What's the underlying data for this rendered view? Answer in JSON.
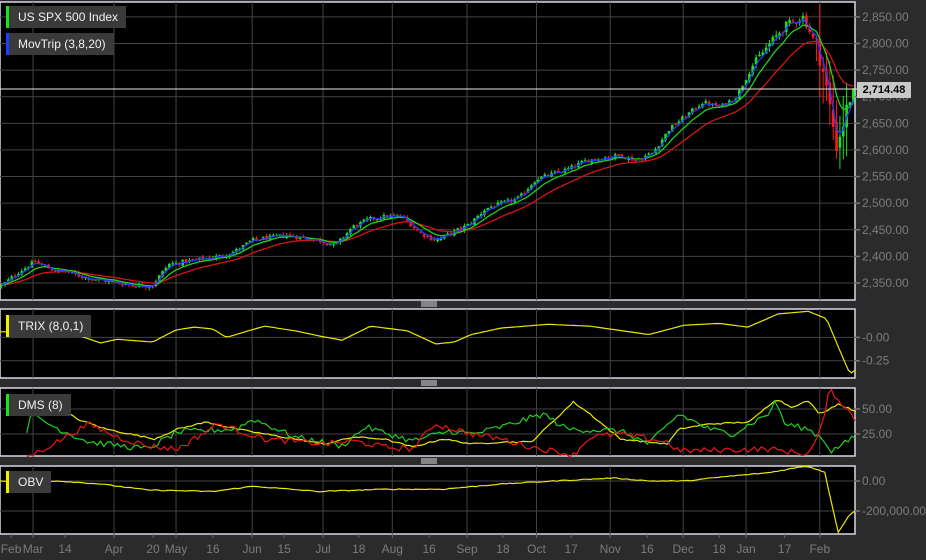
{
  "x_axis": {
    "ticks": [
      {
        "label": "Feb",
        "week": 0.66,
        "grid": false
      },
      {
        "label": "Mar",
        "week": 1.97,
        "grid": true
      },
      {
        "label": "14",
        "week": 3.88,
        "grid": false
      },
      {
        "label": "Apr",
        "week": 6.8,
        "grid": true
      },
      {
        "label": "20",
        "week": 9.13,
        "grid": false
      },
      {
        "label": "May",
        "week": 10.5,
        "grid": true
      },
      {
        "label": "16",
        "week": 12.7,
        "grid": false
      },
      {
        "label": "Jun",
        "week": 15.04,
        "grid": true
      },
      {
        "label": "15",
        "week": 16.95,
        "grid": false
      },
      {
        "label": "Jul",
        "week": 19.27,
        "grid": true
      },
      {
        "label": "18",
        "week": 21.4,
        "grid": false
      },
      {
        "label": "Aug",
        "week": 23.4,
        "grid": true
      },
      {
        "label": "16",
        "week": 25.6,
        "grid": false
      },
      {
        "label": "Sep",
        "week": 27.86,
        "grid": true
      },
      {
        "label": "18",
        "week": 30.0,
        "grid": false
      },
      {
        "label": "Oct",
        "week": 32.0,
        "grid": true
      },
      {
        "label": "17",
        "week": 34.07,
        "grid": false
      },
      {
        "label": "Nov",
        "week": 36.4,
        "grid": true
      },
      {
        "label": "16",
        "week": 38.6,
        "grid": false
      },
      {
        "label": "Dec",
        "week": 40.75,
        "grid": true
      },
      {
        "label": "18",
        "week": 42.9,
        "grid": false
      },
      {
        "label": "Jan",
        "week": 44.5,
        "grid": true
      },
      {
        "label": "17",
        "week": 46.8,
        "grid": false
      },
      {
        "label": "Feb",
        "week": 48.9,
        "grid": true
      }
    ],
    "range_weeks": [
      0,
      51
    ]
  },
  "chart_data": [
    {
      "type": "candlestick",
      "title": "US SPX 500 Index",
      "overlay_title": "MovTrip (3,8,20)",
      "ma_periods": [
        3,
        8,
        20
      ],
      "colors": {
        "up": "#1fe01f",
        "down": "#ff1a1a",
        "ma_fast": "#1f3cff",
        "ma_mid": "#1fd01f",
        "ma_slow": "#d41515",
        "legend_main": "#1fe01f",
        "legend_overlay": "#1f3cff"
      },
      "weekly_closes": [
        2345,
        2370,
        2390,
        2375,
        2370,
        2360,
        2355,
        2350,
        2345,
        2345,
        2385,
        2390,
        2395,
        2400,
        2410,
        2430,
        2435,
        2440,
        2435,
        2430,
        2420,
        2455,
        2470,
        2475,
        2475,
        2445,
        2430,
        2445,
        2460,
        2490,
        2500,
        2510,
        2545,
        2555,
        2565,
        2580,
        2585,
        2590,
        2580,
        2595,
        2640,
        2665,
        2690,
        2680,
        2700,
        2760,
        2800,
        2835,
        2850,
        2780,
        2610,
        2714
      ],
      "last_price": 2714.48,
      "last_price_label": "2,714.48",
      "ylim": [
        2318,
        2878
      ],
      "yticks": [
        {
          "value": 2850,
          "label": "2,850.00"
        },
        {
          "value": 2800,
          "label": "2,800.00"
        },
        {
          "value": 2750,
          "label": "2,750.00"
        },
        {
          "value": 2700,
          "label": "2,700.00"
        },
        {
          "value": 2650,
          "label": "2,650.00"
        },
        {
          "value": 2600,
          "label": "2,600.00"
        },
        {
          "value": 2550,
          "label": "2,550.00"
        },
        {
          "value": 2500,
          "label": "2,500.00"
        },
        {
          "value": 2450,
          "label": "2,450.00"
        },
        {
          "value": 2400,
          "label": "2,400.00"
        },
        {
          "value": 2350,
          "label": "2,350.00"
        }
      ]
    },
    {
      "type": "line",
      "title": "TRIX (8,0,1)",
      "legend_color": "#f0f000",
      "color": "#e8e800",
      "points": [
        [
          0,
          0.06
        ],
        [
          2,
          0.06
        ],
        [
          4.4,
          0.04
        ],
        [
          6.0,
          -0.06
        ],
        [
          7.0,
          -0.02
        ],
        [
          9.1,
          -0.05
        ],
        [
          10.5,
          0.08
        ],
        [
          11.6,
          0.11
        ],
        [
          12.7,
          0.09
        ],
        [
          13.5,
          0.0
        ],
        [
          14.8,
          0.07
        ],
        [
          15.8,
          0.12
        ],
        [
          17.6,
          0.07
        ],
        [
          19.2,
          0.01
        ],
        [
          20.4,
          -0.03
        ],
        [
          22.1,
          0.12
        ],
        [
          24.3,
          0.07
        ],
        [
          26.0,
          -0.07
        ],
        [
          27.1,
          -0.05
        ],
        [
          28.1,
          0.03
        ],
        [
          29.9,
          0.1
        ],
        [
          32.7,
          0.14
        ],
        [
          35.2,
          0.12
        ],
        [
          38.7,
          0.03
        ],
        [
          40.8,
          0.13
        ],
        [
          42.9,
          0.15
        ],
        [
          44.6,
          0.11
        ],
        [
          46.4,
          0.25
        ],
        [
          48.2,
          0.28
        ],
        [
          49.3,
          0.2
        ],
        [
          50.0,
          -0.1
        ],
        [
          50.6,
          -0.35
        ],
        [
          50.8,
          -0.38
        ],
        [
          51,
          -0.35
        ]
      ],
      "ylim": [
        -0.435,
        0.304
      ],
      "yticks": [
        {
          "value": 0,
          "label": "-0.00"
        },
        {
          "value": -0.25,
          "label": "-0.25"
        }
      ]
    },
    {
      "type": "line",
      "title": "DMS (8)",
      "legend_color": "#1fe01f",
      "series": [
        {
          "color": "#e8e800",
          "points": [
            [
              3.2,
              55
            ],
            [
              4.6,
              40
            ],
            [
              6.3,
              30
            ],
            [
              9.2,
              20
            ],
            [
              10.6,
              30
            ],
            [
              12.3,
              37
            ],
            [
              14.1,
              30
            ],
            [
              15.8,
              25
            ],
            [
              19.4,
              15
            ],
            [
              21.1,
              22
            ],
            [
              22.9,
              20
            ],
            [
              24.6,
              12
            ],
            [
              26.4,
              20
            ],
            [
              28.2,
              15
            ],
            [
              29.9,
              17
            ],
            [
              31.7,
              17
            ],
            [
              34.2,
              57
            ],
            [
              35.2,
              45
            ],
            [
              37,
              20
            ],
            [
              39.8,
              15
            ],
            [
              40.5,
              30
            ],
            [
              42.3,
              35
            ],
            [
              44.7,
              37
            ],
            [
              46.3,
              60
            ],
            [
              47.2,
              52
            ],
            [
              48.2,
              58
            ],
            [
              48.9,
              45
            ],
            [
              50,
              55
            ],
            [
              51,
              48
            ]
          ]
        },
        {
          "color": "#1fd01f",
          "points": [
            [
              1.6,
              28
            ],
            [
              1.8,
              45
            ],
            [
              3.5,
              30
            ],
            [
              5.3,
              17
            ],
            [
              8.8,
              10
            ],
            [
              10.6,
              27
            ],
            [
              14.1,
              30
            ],
            [
              15.1,
              40
            ],
            [
              17.6,
              22
            ],
            [
              20.4,
              13
            ],
            [
              21.8,
              32
            ],
            [
              24.6,
              18
            ],
            [
              26.8,
              28
            ],
            [
              28.2,
              25
            ],
            [
              29.9,
              32
            ],
            [
              32.4,
              45
            ],
            [
              33.8,
              30
            ],
            [
              37,
              28
            ],
            [
              38.7,
              15
            ],
            [
              40.5,
              45
            ],
            [
              42.3,
              30
            ],
            [
              43.7,
              25
            ],
            [
              45.8,
              45
            ],
            [
              46.3,
              58
            ],
            [
              46.8,
              35
            ],
            [
              48.2,
              30
            ],
            [
              49.1,
              20
            ],
            [
              49.6,
              8
            ],
            [
              51,
              22
            ]
          ]
        },
        {
          "color": "#ee1515",
          "points": [
            [
              1.6,
              3
            ],
            [
              1.8,
              3
            ],
            [
              3.5,
              18
            ],
            [
              5.3,
              35
            ],
            [
              7,
              22
            ],
            [
              8.8,
              13
            ],
            [
              10.6,
              10
            ],
            [
              13,
              35
            ],
            [
              15.8,
              20
            ],
            [
              19.4,
              15
            ],
            [
              21.1,
              18
            ],
            [
              22.9,
              12
            ],
            [
              24.6,
              10
            ],
            [
              25.9,
              35
            ],
            [
              28.2,
              25
            ],
            [
              29.9,
              20
            ],
            [
              31.7,
              12
            ],
            [
              34.2,
              4
            ],
            [
              35.2,
              22
            ],
            [
              37,
              25
            ],
            [
              39.8,
              17
            ],
            [
              40.5,
              8
            ],
            [
              45.8,
              10
            ],
            [
              48.2,
              5
            ],
            [
              48.9,
              25
            ],
            [
              49.5,
              70
            ],
            [
              50,
              60
            ],
            [
              51,
              40
            ]
          ]
        }
      ],
      "ylim": [
        3,
        71
      ],
      "yticks": [
        {
          "value": 50,
          "label": "50.00"
        },
        {
          "value": 25,
          "label": "25.00"
        }
      ]
    },
    {
      "type": "line",
      "title": "OBV",
      "legend_color": "#f0f000",
      "color": "#e8e800",
      "points": [
        [
          0,
          0
        ],
        [
          3.5,
          0
        ],
        [
          6,
          -20000
        ],
        [
          8.8,
          -60000
        ],
        [
          12.7,
          -70000
        ],
        [
          15.1,
          -35000
        ],
        [
          19,
          -70000
        ],
        [
          22.9,
          -55000
        ],
        [
          26.4,
          -55000
        ],
        [
          29.9,
          -20000
        ],
        [
          33,
          0
        ],
        [
          36.6,
          20000
        ],
        [
          38.8,
          0
        ],
        [
          40.9,
          0
        ],
        [
          43.3,
          30000
        ],
        [
          45.8,
          55000
        ],
        [
          48.1,
          100000
        ],
        [
          49.2,
          60000
        ],
        [
          49.5,
          -100000
        ],
        [
          50,
          -340000
        ],
        [
          50.7,
          -220000
        ],
        [
          51,
          -200000
        ]
      ],
      "ylim": [
        -353333,
        100000
      ],
      "yticks": [
        {
          "value": 0,
          "label": "0.00"
        },
        {
          "value": -200000,
          "label": "-200,000.00"
        }
      ]
    }
  ]
}
